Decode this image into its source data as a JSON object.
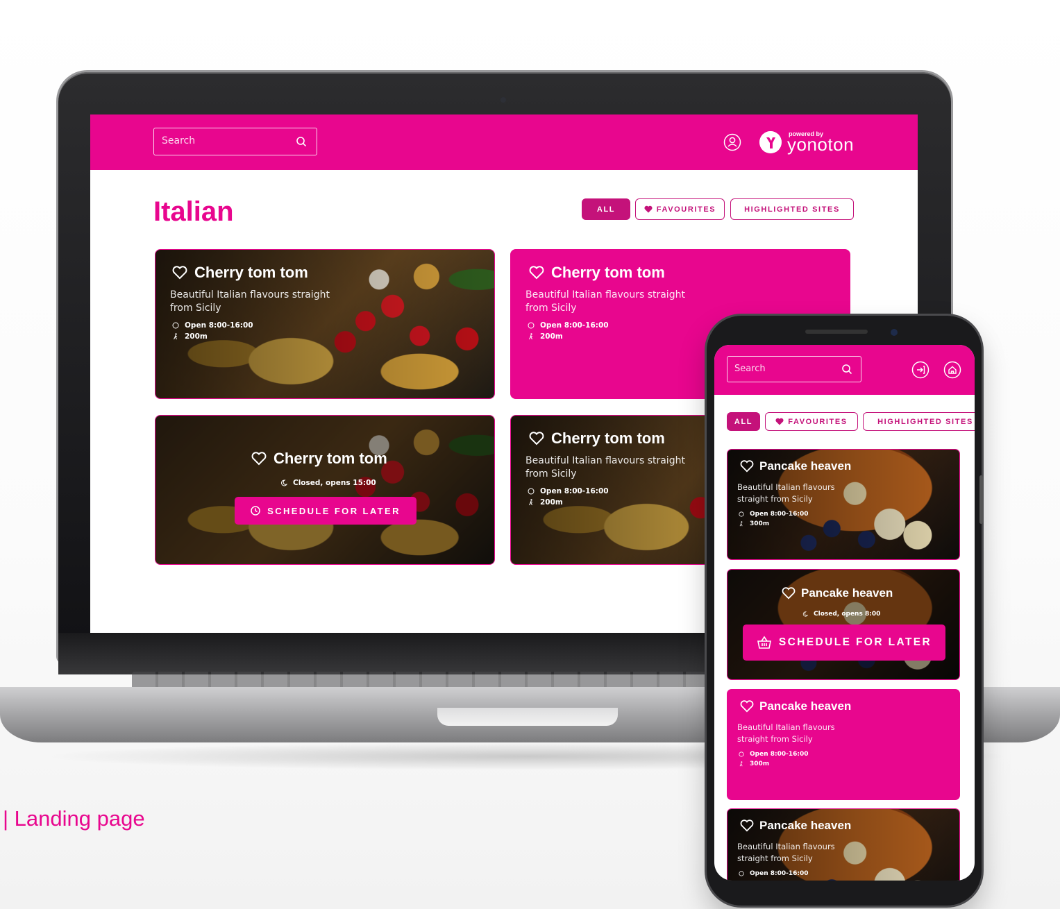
{
  "colors": {
    "brand": "#e8068e",
    "brand_dark": "#c4127a",
    "white": "#ffffff"
  },
  "desktop": {
    "search_placeholder": "Search",
    "brand_powered": "powered by",
    "brand_name": "yonoton",
    "page_title": "Italian",
    "filters": {
      "all": "ALL",
      "favourites": "FAVOURITES",
      "highlighted": "HIGHLIGHTED SITES"
    },
    "cards": [
      {
        "title": "Cherry tom tom",
        "desc1": "Beautiful Italian flavours straight",
        "desc2": "from Sicily",
        "hours": "Open 8:00-16:00",
        "distance": "200m"
      },
      {
        "title": "Cherry tom tom",
        "desc1": "Beautiful Italian flavours straight",
        "desc2": "from Sicily",
        "hours": "Open 8:00-16:00",
        "distance": "200m"
      },
      {
        "title": "Cherry tom tom",
        "status": "Closed, opens 15:00",
        "button": "SCHEDULE FOR LATER"
      },
      {
        "title": "Cherry tom tom",
        "desc1": "Beautiful Italian flavours straight",
        "desc2": "from Sicily",
        "hours": "Open 8:00-16:00",
        "distance": "200m"
      }
    ]
  },
  "mobile": {
    "search_placeholder": "Search",
    "filters": {
      "all": "ALL",
      "favourites": "FAVOURITES",
      "highlighted": "HIGHLIGHTED SITES"
    },
    "cards": [
      {
        "title": "Pancake heaven",
        "desc1": "Beautiful Italian flavours",
        "desc2": "straight from Sicily",
        "hours": "Open 8:00-16:00",
        "distance": "300m"
      },
      {
        "title": "Pancake heaven",
        "status": "Closed, opens 8:00",
        "button": "SCHEDULE FOR LATER"
      },
      {
        "title": "Pancake heaven",
        "desc1": "Beautiful Italian flavours",
        "desc2": "straight from Sicily",
        "hours": "Open 8:00-16:00",
        "distance": "300m"
      },
      {
        "title": "Pancake heaven",
        "desc1": "Beautiful Italian flavours",
        "desc2": "straight from Sicily",
        "hours": "Open 8:00-16:00"
      }
    ]
  },
  "caption": "|  Landing page"
}
